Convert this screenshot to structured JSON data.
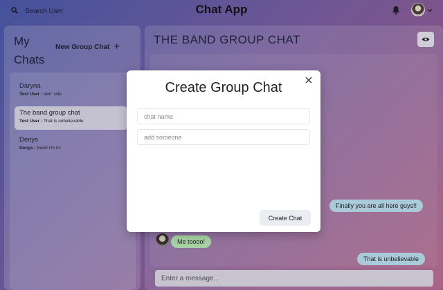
{
  "header": {
    "search_label": "Search User",
    "app_title": "Chat App"
  },
  "sidebar": {
    "title": "My Chats",
    "new_group_label": "New Group Chat",
    "chats": [
      {
        "name": "Daryna",
        "sender": "Test User :",
        "preview": "skin' sski",
        "active": false
      },
      {
        "name": "The band group chat",
        "sender": "Test User :",
        "preview": "That is unbelievable",
        "active": true
      },
      {
        "name": "Denys",
        "sender": "Denys :",
        "preview": "Sure! I'm in!",
        "active": false
      }
    ]
  },
  "chat": {
    "title": "THE BAND GROUP CHAT",
    "messages": [
      {
        "text": "Finally you are all here guys!!",
        "from": "me"
      },
      {
        "text": "Me toooo!",
        "from": "other"
      },
      {
        "text": "That is unbelievable",
        "from": "me"
      }
    ],
    "input_placeholder": "Enter a message.."
  },
  "modal": {
    "title": "Create Group Chat",
    "chat_name_placeholder": "chat name",
    "add_user_placeholder": "add someone",
    "create_label": "Create Chat"
  },
  "icons": {
    "search": "search-icon",
    "bell": "bell-icon",
    "avatar_menu": "chevron-down-icon",
    "add": "plus-icon",
    "view": "eye-icon",
    "close": "close-icon"
  },
  "colors": {
    "bubble_me": "#bcdfec",
    "bubble_other": "#b8e8b0",
    "active_chat": "#d9d6e4"
  }
}
